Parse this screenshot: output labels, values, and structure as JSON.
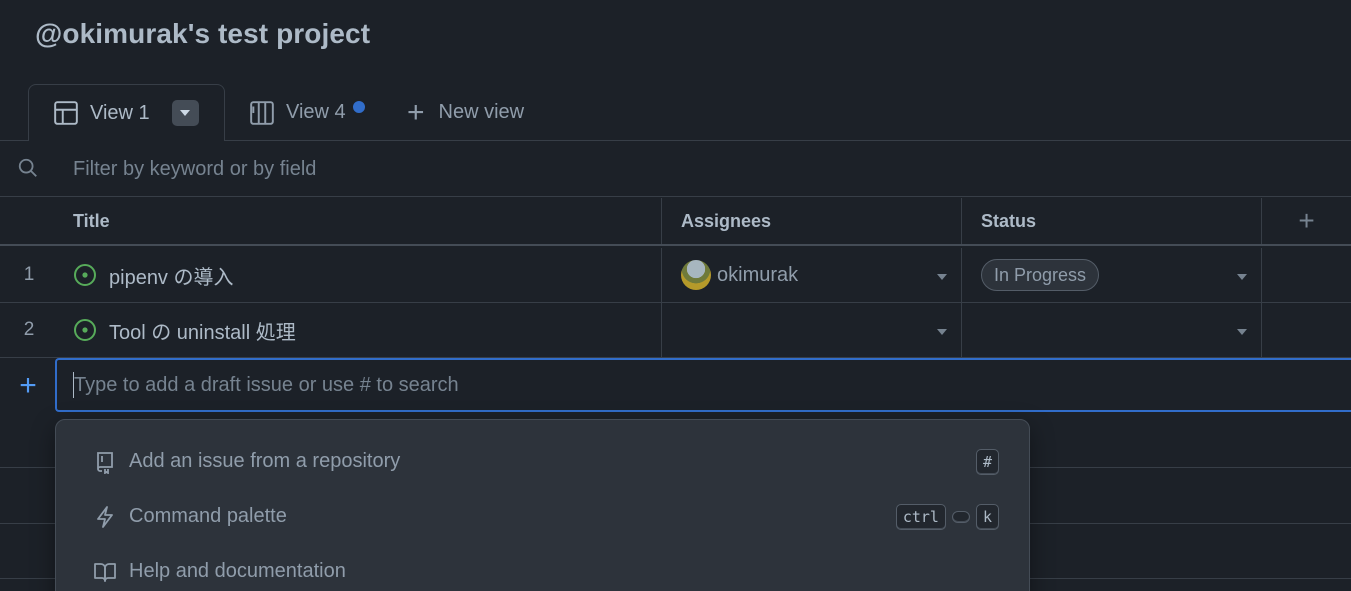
{
  "project": {
    "title": "@okimurak's test project"
  },
  "tabs": [
    {
      "label": "View 1",
      "icon": "table-icon",
      "active": true
    },
    {
      "label": "View 4",
      "icon": "board-icon",
      "unsaved_dot": true
    },
    {
      "label": "New view",
      "icon": "plus-icon"
    }
  ],
  "filter": {
    "placeholder": "Filter by keyword or by field"
  },
  "table": {
    "columns": [
      "Title",
      "Assignees",
      "Status"
    ],
    "add_column_label": "+",
    "rows": [
      {
        "num": "1",
        "title": "pipenv の導入",
        "assignee": "okimurak",
        "status": "In Progress"
      },
      {
        "num": "2",
        "title": "Tool の uninstall 処理",
        "assignee": "",
        "status": ""
      }
    ]
  },
  "add_item": {
    "plus": "+",
    "placeholder": "Type to add a draft issue or use # to search"
  },
  "menu": {
    "items": [
      {
        "label": "Add an issue from a repository",
        "icon": "repo-icon",
        "keys": [
          "#"
        ]
      },
      {
        "label": "Command palette",
        "icon": "zap-icon",
        "keys": [
          "ctrl",
          "",
          "k"
        ]
      },
      {
        "label": "Help and documentation",
        "icon": "book-icon",
        "keys": []
      }
    ]
  },
  "colors": {
    "background": "#1c2128",
    "accent": "#316dca",
    "open_issue": "#57ab5a"
  }
}
